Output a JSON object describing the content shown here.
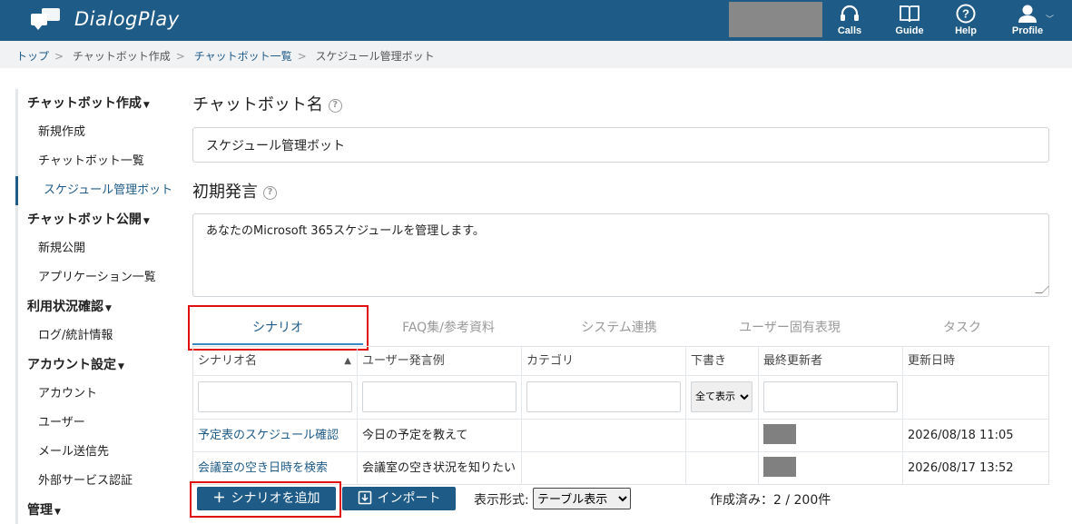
{
  "header": {
    "app_name": "DialogPlay",
    "nav": [
      {
        "label": "Calls",
        "icon": "headset-icon"
      },
      {
        "label": "Guide",
        "icon": "book-icon"
      },
      {
        "label": "Help",
        "icon": "help-icon"
      },
      {
        "label": "Profile",
        "icon": "user-icon"
      }
    ]
  },
  "breadcrumb": [
    "トップ",
    "チャットボット作成",
    "チャットボット一覧",
    "スケジュール管理ボット"
  ],
  "sidebar": {
    "sections": [
      {
        "title": "チャットボット作成",
        "items": [
          "新規作成",
          "チャットボット一覧",
          "スケジュール管理ボット"
        ]
      },
      {
        "title": "チャットボット公開",
        "items": [
          "新規公開",
          "アプリケーション一覧"
        ]
      },
      {
        "title": "利用状況確認",
        "items": [
          "ログ/統計情報"
        ]
      },
      {
        "title": "アカウント設定",
        "items": [
          "アカウント",
          "ユーザー",
          "メール送信先",
          "外部サービス認証"
        ]
      },
      {
        "title": "管理",
        "items": []
      }
    ]
  },
  "form": {
    "name_label": "チャットボット名",
    "name_value": "スケジュール管理ボット",
    "greeting_label": "初期発言",
    "greeting_value": "あなたのMicrosoft 365スケジュールを管理します。"
  },
  "tabs": [
    "シナリオ",
    "FAQ集/参考資料",
    "システム連携",
    "ユーザー固有表現",
    "タスク"
  ],
  "table": {
    "columns": [
      "シナリオ名",
      "ユーザー発言例",
      "カテゴリ",
      "下書き",
      "最終更新者",
      "更新日時"
    ],
    "draft_filter": "全て表示",
    "rows": [
      {
        "name": "予定表のスケジュール確認",
        "example": "今日の予定を教えて",
        "category": "",
        "draft": "",
        "updated": "2026/08/18 11:05"
      },
      {
        "name": "会議室の空き日時を検索",
        "example": "会議室の空き状況を知りたい",
        "category": "",
        "draft": "",
        "updated": "2026/08/17 13:52"
      }
    ]
  },
  "footer": {
    "add_button": "シナリオを追加",
    "import_button": "インポート",
    "format_label": "表示形式:",
    "format_value": "テーブル表示",
    "count": "作成済み：2 / 200件"
  },
  "colors": {
    "header": "#1f5b87",
    "accent": "#3b89c3",
    "highlight": "#e01010"
  }
}
